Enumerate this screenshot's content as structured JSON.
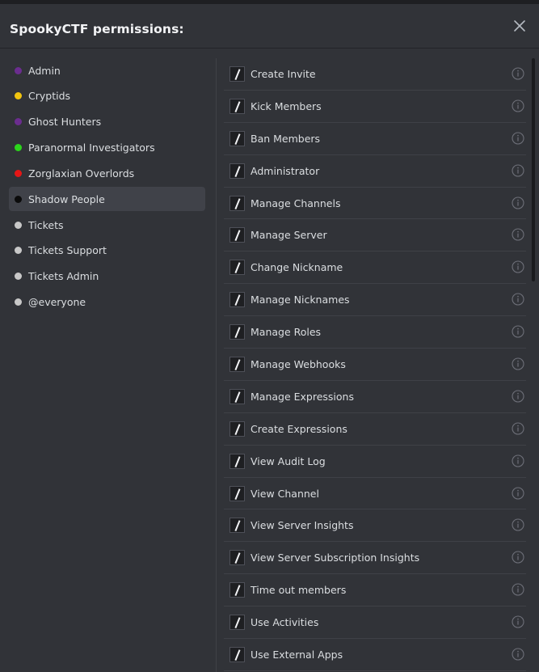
{
  "dialog": {
    "title": "SpookyCTF permissions:"
  },
  "roles": [
    {
      "label": "Admin",
      "color": "#6b2d8f"
    },
    {
      "label": "Cryptids",
      "color": "#f1c40f"
    },
    {
      "label": "Ghost Hunters",
      "color": "#6b2d8f"
    },
    {
      "label": "Paranormal Investigators",
      "color": "#2bd51b"
    },
    {
      "label": "Zorglaxian Overlords",
      "color": "#e51616"
    },
    {
      "label": "Shadow People",
      "color": "#0b0b0b",
      "selected": true
    },
    {
      "label": "Tickets",
      "color": "#c8c8c8"
    },
    {
      "label": "Tickets Support",
      "color": "#c8c8c8"
    },
    {
      "label": "Tickets Admin",
      "color": "#c8c8c8"
    },
    {
      "label": "@everyone",
      "color": "#c8c8c8"
    }
  ],
  "permissions": [
    {
      "label": "Create Invite"
    },
    {
      "label": "Kick Members"
    },
    {
      "label": "Ban Members"
    },
    {
      "label": "Administrator"
    },
    {
      "label": "Manage Channels"
    },
    {
      "label": "Manage Server"
    },
    {
      "label": "Change Nickname"
    },
    {
      "label": "Manage Nicknames"
    },
    {
      "label": "Manage Roles"
    },
    {
      "label": "Manage Webhooks"
    },
    {
      "label": "Manage Expressions"
    },
    {
      "label": "Create Expressions"
    },
    {
      "label": "View Audit Log"
    },
    {
      "label": "View Channel"
    },
    {
      "label": "View Server Insights"
    },
    {
      "label": "View Server Subscription Insights"
    },
    {
      "label": "Time out members"
    },
    {
      "label": "Use Activities"
    },
    {
      "label": "Use External Apps"
    }
  ],
  "icons": {
    "close": "close-icon",
    "info": "info-icon",
    "toggle": "neutral-slash-icon"
  }
}
